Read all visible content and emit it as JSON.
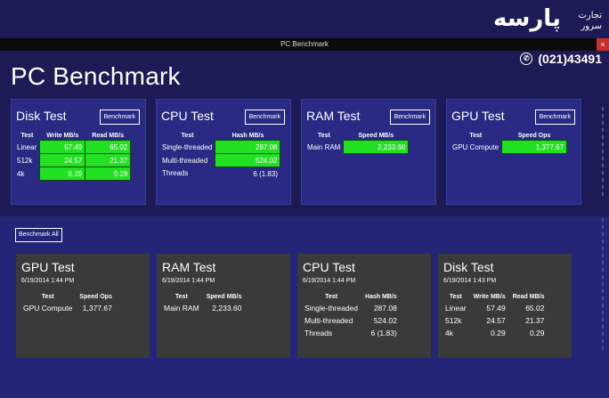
{
  "window": {
    "title": "PC Benchmark",
    "close_glyph": "×"
  },
  "page": {
    "title": "PC Benchmark"
  },
  "logo": {
    "name": "پارسه",
    "line1": "تجارت",
    "line2": "سرور",
    "phone": "(021)43491"
  },
  "top_tiles": [
    {
      "title": "Disk Test",
      "button": "Benchmark",
      "headers": [
        "Test",
        "Write MB/s",
        "Read MB/s"
      ],
      "rows": [
        [
          "Linear",
          "57.49",
          "65.02"
        ],
        [
          "512k",
          "24.57",
          "21.37"
        ],
        [
          "4k",
          "0.29",
          "0.29"
        ]
      ]
    },
    {
      "title": "CPU Test",
      "button": "Benchmark",
      "headers": [
        "Test",
        "Hash MB/s"
      ],
      "rows": [
        [
          "Single-threaded",
          "287.08"
        ],
        [
          "Multi-threaded",
          "524.02"
        ],
        [
          "Threads",
          "6 (1.83)"
        ]
      ]
    },
    {
      "title": "RAM Test",
      "button": "Benchmark",
      "headers": [
        "Test",
        "Speed MB/s"
      ],
      "rows": [
        [
          "Main RAM",
          "2,233.60"
        ]
      ]
    },
    {
      "title": "GPU Test",
      "button": "Benchmark",
      "headers": [
        "Test",
        "Speed Ops"
      ],
      "rows": [
        [
          "GPU Compute",
          "1,377.67"
        ]
      ]
    }
  ],
  "benchmark_all": "Benchmark All",
  "history": [
    {
      "title": "GPU Test",
      "date": "6/19/2014 1:44 PM",
      "headers": [
        "Test",
        "Speed Ops"
      ],
      "rows": [
        [
          "GPU Compute",
          "1,377.67"
        ]
      ]
    },
    {
      "title": "RAM Test",
      "date": "6/19/2014 1:44 PM",
      "headers": [
        "Test",
        "Speed MB/s"
      ],
      "rows": [
        [
          "Main RAM",
          "2,233.60"
        ]
      ]
    },
    {
      "title": "CPU Test",
      "date": "6/19/2014 1:44 PM",
      "headers": [
        "Test",
        "Hash MB/s"
      ],
      "rows": [
        [
          "Single-threaded",
          "287.08"
        ],
        [
          "Multi-threaded",
          "524.02"
        ],
        [
          "Threads",
          "6 (1.83)"
        ]
      ]
    },
    {
      "title": "Disk Test",
      "date": "6/19/2014 1:43 PM",
      "headers": [
        "Test",
        "Write MB/s",
        "Read MB/s"
      ],
      "rows": [
        [
          "Linear",
          "57.49",
          "65.02"
        ],
        [
          "512k",
          "24.57",
          "21.37"
        ],
        [
          "4k",
          "0.29",
          "0.29"
        ]
      ]
    }
  ],
  "colors": {
    "background": "#1d1b55",
    "tile": "#2a2a85",
    "history_tile": "#3a3a3a",
    "highlight": "#22e022",
    "close": "#c7302c"
  }
}
